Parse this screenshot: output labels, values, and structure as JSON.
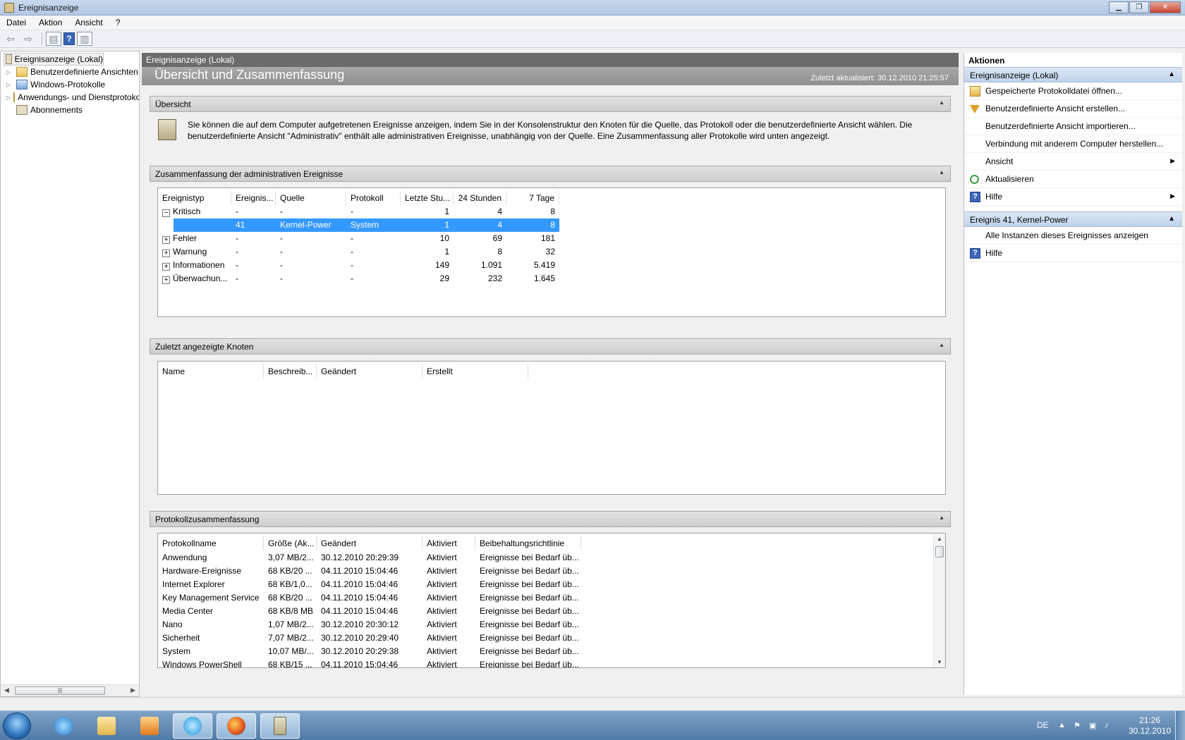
{
  "window": {
    "title": "Ereignisanzeige"
  },
  "menu": [
    "Datei",
    "Aktion",
    "Ansicht",
    "?"
  ],
  "tree": {
    "root": "Ereignisanzeige (Lokal)",
    "items": [
      {
        "label": "Benutzerdefinierte Ansichten",
        "expandable": true
      },
      {
        "label": "Windows-Protokolle",
        "expandable": true
      },
      {
        "label": "Anwendungs- und Dienstprotokolle",
        "expandable": true
      },
      {
        "label": "Abonnements",
        "expandable": false
      }
    ]
  },
  "center": {
    "header": "Ereignisanzeige (Lokal)",
    "heading": "Übersicht und Zusammenfassung",
    "updated": "Zuletzt aktualisiert: 30.12.2010 21:25:57",
    "overview": {
      "title": "Übersicht",
      "text": "Sie können die auf dem Computer aufgetretenen Ereignisse anzeigen, indem Sie in der Konsolenstruktur den Knoten für die Quelle, das Protokoll oder die benutzerdefinierte Ansicht wählen. Die benutzerdefinierte Ansicht \"Administrativ\" enthält alle administrativen Ereignisse, unabhängig von der Quelle. Eine Zusammenfassung aller Protokolle wird unten angezeigt."
    },
    "summary": {
      "title": "Zusammenfassung der administrativen Ereignisse",
      "columns": [
        "Ereignistyp",
        "Ereignis...",
        "Quelle",
        "Protokoll",
        "Letzte Stu...",
        "24 Stunden",
        "7 Tage"
      ],
      "rows": [
        {
          "type": "Kritisch",
          "toggle": "−",
          "id": "-",
          "source": "-",
          "log": "-",
          "hour": "1",
          "day": "4",
          "week": "8"
        },
        {
          "type": "",
          "toggle": "",
          "id": "41",
          "source": "Kernel-Power",
          "log": "System",
          "hour": "1",
          "day": "4",
          "week": "8",
          "selected": true
        },
        {
          "type": "Fehler",
          "toggle": "+",
          "id": "-",
          "source": "-",
          "log": "-",
          "hour": "10",
          "day": "69",
          "week": "181"
        },
        {
          "type": "Warnung",
          "toggle": "+",
          "id": "-",
          "source": "-",
          "log": "-",
          "hour": "1",
          "day": "8",
          "week": "32"
        },
        {
          "type": "Informationen",
          "toggle": "+",
          "id": "-",
          "source": "-",
          "log": "-",
          "hour": "149",
          "day": "1.091",
          "week": "5.419"
        },
        {
          "type": "Überwachun...",
          "toggle": "+",
          "id": "-",
          "source": "-",
          "log": "-",
          "hour": "29",
          "day": "232",
          "week": "1.645"
        }
      ]
    },
    "recent": {
      "title": "Zuletzt angezeigte Knoten",
      "columns": [
        "Name",
        "Beschreib...",
        "Geändert",
        "Erstellt"
      ]
    },
    "logs": {
      "title": "Protokollzusammenfassung",
      "columns": [
        "Protokollname",
        "Größe (Ak...",
        "Geändert",
        "Aktiviert",
        "Beibehaltungsrichtlinie"
      ],
      "rows": [
        {
          "name": "Anwendung",
          "size": "3,07 MB/2...",
          "changed": "30.12.2010 20:29:39",
          "enabled": "Aktiviert",
          "policy": "Ereignisse bei Bedarf üb..."
        },
        {
          "name": "Hardware-Ereignisse",
          "size": "68 KB/20 ...",
          "changed": "04.11.2010 15:04:46",
          "enabled": "Aktiviert",
          "policy": "Ereignisse bei Bedarf üb..."
        },
        {
          "name": "Internet Explorer",
          "size": "68 KB/1,0...",
          "changed": "04.11.2010 15:04:46",
          "enabled": "Aktiviert",
          "policy": "Ereignisse bei Bedarf üb..."
        },
        {
          "name": "Key Management Service",
          "size": "68 KB/20 ...",
          "changed": "04.11.2010 15:04:46",
          "enabled": "Aktiviert",
          "policy": "Ereignisse bei Bedarf üb..."
        },
        {
          "name": "Media Center",
          "size": "68 KB/8 MB",
          "changed": "04.11.2010 15:04:46",
          "enabled": "Aktiviert",
          "policy": "Ereignisse bei Bedarf üb..."
        },
        {
          "name": "Nano",
          "size": "1,07 MB/2...",
          "changed": "30.12.2010 20:30:12",
          "enabled": "Aktiviert",
          "policy": "Ereignisse bei Bedarf üb..."
        },
        {
          "name": "Sicherheit",
          "size": "7,07 MB/2...",
          "changed": "30.12.2010 20:29:40",
          "enabled": "Aktiviert",
          "policy": "Ereignisse bei Bedarf üb..."
        },
        {
          "name": "System",
          "size": "10,07 MB/...",
          "changed": "30.12.2010 20:29:38",
          "enabled": "Aktiviert",
          "policy": "Ereignisse bei Bedarf üb..."
        },
        {
          "name": "Windows PowerShell",
          "size": "68 KB/15 ...",
          "changed": "04.11.2010 15:04:46",
          "enabled": "Aktiviert",
          "policy": "Ereignisse bei Bedarf üb..."
        }
      ]
    }
  },
  "actions": {
    "title": "Aktionen",
    "groups": [
      {
        "title": "Ereignisanzeige (Lokal)",
        "items": [
          {
            "label": "Gespeicherte Protokolldatei öffnen...",
            "icon": "open-log-icon"
          },
          {
            "label": "Benutzerdefinierte Ansicht erstellen...",
            "icon": "filter-icon"
          },
          {
            "label": "Benutzerdefinierte Ansicht importieren...",
            "icon": ""
          },
          {
            "label": "Verbindung mit anderem Computer herstellen...",
            "icon": ""
          },
          {
            "label": "Ansicht",
            "icon": "",
            "submenu": true
          },
          {
            "label": "Aktualisieren",
            "icon": "refresh-icon"
          },
          {
            "label": "Hilfe",
            "icon": "help-icon",
            "submenu": true
          }
        ]
      },
      {
        "title": "Ereignis 41, Kernel-Power",
        "items": [
          {
            "label": "Alle Instanzen dieses Ereignisses anzeigen",
            "icon": ""
          },
          {
            "label": "Hilfe",
            "icon": "help-icon"
          }
        ]
      }
    ]
  },
  "taskbar": {
    "lang": "DE",
    "time": "21:26",
    "date": "30.12.2010",
    "apps": [
      "internet-explorer-icon",
      "explorer-icon",
      "media-player-icon",
      "skype-icon",
      "firefox-icon",
      "event-viewer-icon"
    ]
  },
  "colors": {
    "selection": "#3399ff",
    "accent": "#c0d3ec",
    "header": "#6b6b6b"
  }
}
